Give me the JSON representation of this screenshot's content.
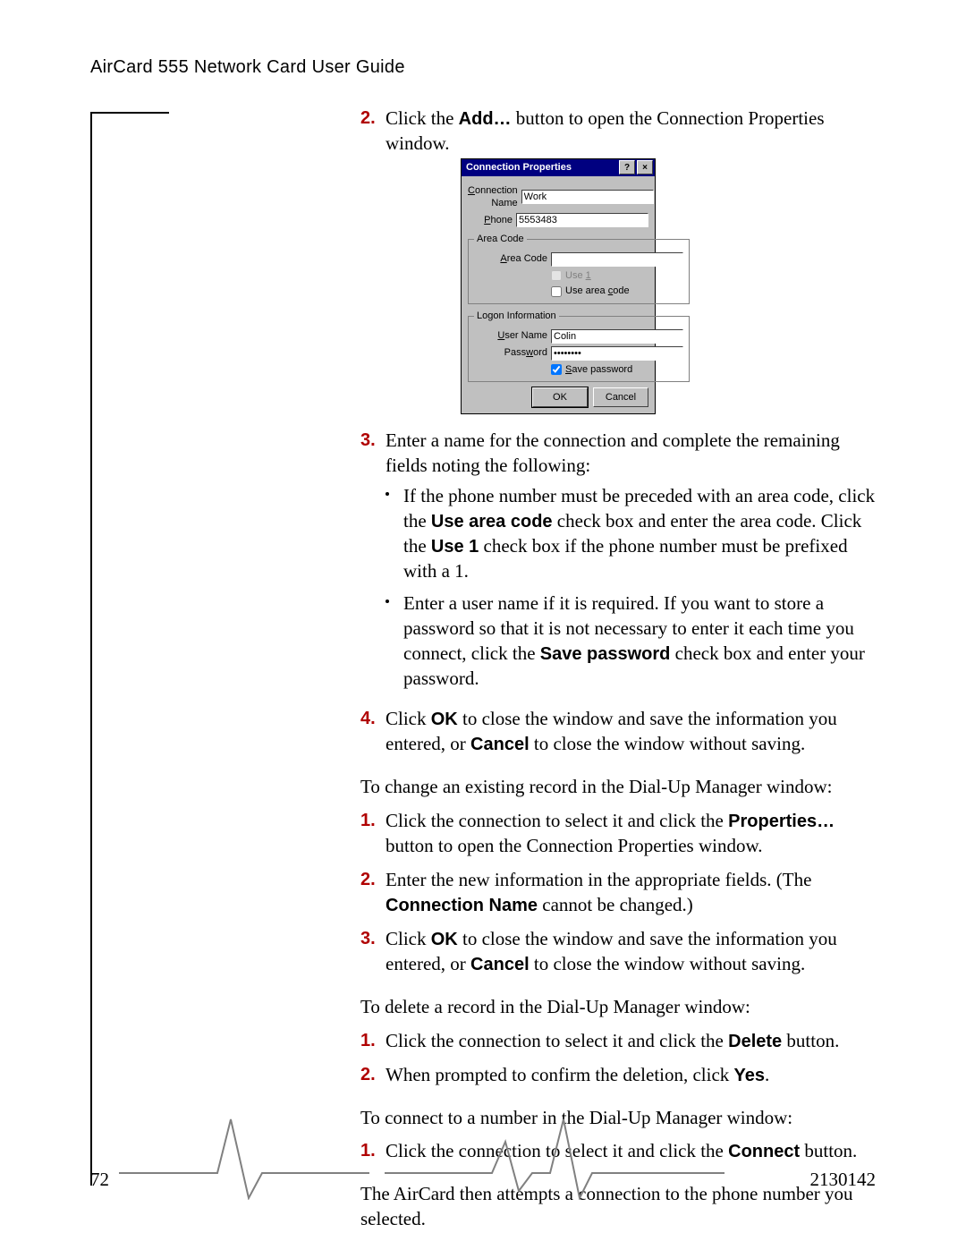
{
  "header": {
    "title": "AirCard 555 Network Card User Guide"
  },
  "steps_a": {
    "n2": "2.",
    "s2a": "Click the ",
    "s2_bold": "Add…",
    "s2b": " button to open the Connection Properties window.",
    "n3": "3.",
    "s3": "Enter a name for the connection and complete the remaining fields noting the following:",
    "b1a": "If the phone number must be preceded with an area code, click the ",
    "b1_bold1": "Use area code",
    "b1b": " check box and enter the area code. Click the ",
    "b1_bold2": "Use 1",
    "b1c": " check box if the phone number must be prefixed with a 1.",
    "b2a": "Enter a user name if it is required. If you want to store a password so that it is not necessary to enter it each time you connect, click the ",
    "b2_bold": "Save password",
    "b2b": " check box and enter your password.",
    "n4": "4.",
    "s4a": "Click ",
    "s4_bold1": "OK",
    "s4b": " to close the window and save the information you entered, or ",
    "s4_bold2": "Cancel",
    "s4c": " to close the window without saving."
  },
  "para_change": "To change an existing record in the Dial-Up Manager window:",
  "steps_b": {
    "n1": "1.",
    "s1a": "Click the connection to select it and click the ",
    "s1_bold": "Properties…",
    "s1b": " button to open the Connection Properties window.",
    "n2": "2.",
    "s2a": "Enter the new information in the appropriate fields. (The ",
    "s2_bold": "Connection Name",
    "s2b": " cannot be changed.)",
    "n3": "3.",
    "s3a": "Click ",
    "s3_bold1": "OK",
    "s3b": " to close the window and save the information you entered, or ",
    "s3_bold2": "Cancel",
    "s3c": " to close the window without saving."
  },
  "para_delete": "To delete a record in the Dial-Up Manager window:",
  "steps_c": {
    "n1": "1.",
    "s1a": "Click the connection to select it and click the ",
    "s1_bold": "Delete",
    "s1b": " button.",
    "n2": "2.",
    "s2a": "When prompted to confirm the deletion, click ",
    "s2_bold": "Yes",
    "s2b": "."
  },
  "para_connect": "To connect to a number in the Dial-Up Manager window:",
  "steps_d": {
    "n1": "1.",
    "s1a": "Click the connection to select it and click the ",
    "s1_bold": "Connect",
    "s1b": " button."
  },
  "para_final": "The AirCard then attempts a connection to the phone number you selected.",
  "dialog": {
    "title": "Connection Properties",
    "help": "?",
    "close": "×",
    "conn_label": "Connection Name",
    "conn_value": "Work",
    "phone_label": "Phone",
    "phone_value": "5553483",
    "group_area": "Area Code",
    "area_label": "Area Code",
    "area_value": "",
    "use1": "Use 1",
    "use_area": "Use area code",
    "group_logon": "Logon Information",
    "user_label": "User Name",
    "user_value": "Colin",
    "pass_label": "Password",
    "pass_value": "••••••••",
    "savepw": "Save password",
    "ok": "OK",
    "cancel": "Cancel"
  },
  "footer": {
    "page": "72",
    "docnum": "2130142"
  }
}
